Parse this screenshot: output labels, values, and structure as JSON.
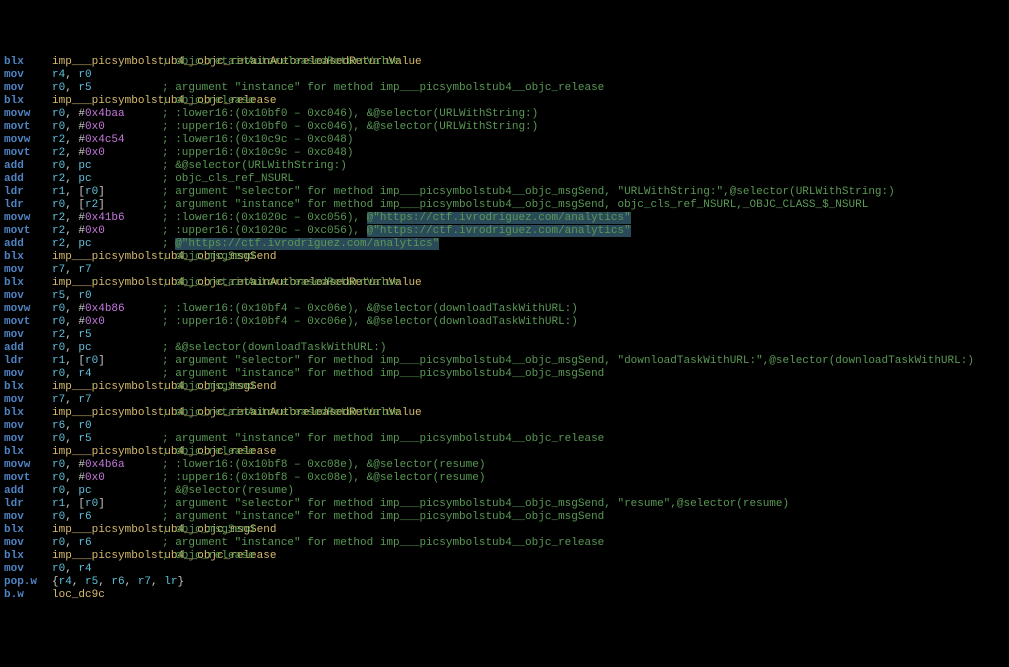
{
  "lines": [
    {
      "mn": "blx",
      "op": [
        {
          "t": "sym",
          "v": "imp___picsymbolstub4__objc_retainAutoreleasedReturnValue"
        }
      ],
      "cmt": "; objc_retainAutoreleasedReturnValue"
    },
    {
      "mn": "mov",
      "op": [
        {
          "t": "reg",
          "v": "r4"
        },
        {
          "t": "pnc",
          "v": ", "
        },
        {
          "t": "reg",
          "v": "r0"
        }
      ]
    },
    {
      "mn": "mov",
      "op": [
        {
          "t": "reg",
          "v": "r0"
        },
        {
          "t": "pnc",
          "v": ", "
        },
        {
          "t": "reg",
          "v": "r5"
        }
      ],
      "cmt": "; argument \"instance\" for method imp___picsymbolstub4__objc_release"
    },
    {
      "mn": "blx",
      "op": [
        {
          "t": "sym",
          "v": "imp___picsymbolstub4__objc_release"
        }
      ],
      "cmt": "; objc_release"
    },
    {
      "mn": "movw",
      "op": [
        {
          "t": "reg",
          "v": "r0"
        },
        {
          "t": "pnc",
          "v": ", #"
        },
        {
          "t": "num",
          "v": "0x4baa"
        }
      ],
      "cmt": "; :lower16:(0x10bf0 – 0xc046), &@selector(URLWithString:)"
    },
    {
      "mn": "movt",
      "op": [
        {
          "t": "reg",
          "v": "r0"
        },
        {
          "t": "pnc",
          "v": ", #"
        },
        {
          "t": "num",
          "v": "0x0"
        }
      ],
      "cmt": "; :upper16:(0x10bf0 – 0xc046), &@selector(URLWithString:)"
    },
    {
      "mn": "movw",
      "op": [
        {
          "t": "reg",
          "v": "r2"
        },
        {
          "t": "pnc",
          "v": ", #"
        },
        {
          "t": "num",
          "v": "0x4c54"
        }
      ],
      "cmt": "; :lower16:(0x10c9c – 0xc048)"
    },
    {
      "mn": "movt",
      "op": [
        {
          "t": "reg",
          "v": "r2"
        },
        {
          "t": "pnc",
          "v": ", #"
        },
        {
          "t": "num",
          "v": "0x0"
        }
      ],
      "cmt": "; :upper16:(0x10c9c – 0xc048)"
    },
    {
      "mn": "add",
      "op": [
        {
          "t": "reg",
          "v": "r0"
        },
        {
          "t": "pnc",
          "v": ", "
        },
        {
          "t": "reg",
          "v": "pc"
        }
      ],
      "cmt": "; &@selector(URLWithString:)"
    },
    {
      "mn": "add",
      "op": [
        {
          "t": "reg",
          "v": "r2"
        },
        {
          "t": "pnc",
          "v": ", "
        },
        {
          "t": "reg",
          "v": "pc"
        }
      ],
      "cmt": "; objc_cls_ref_NSURL"
    },
    {
      "mn": "ldr",
      "op": [
        {
          "t": "reg",
          "v": "r1"
        },
        {
          "t": "pnc",
          "v": ", ["
        },
        {
          "t": "reg",
          "v": "r0"
        },
        {
          "t": "pnc",
          "v": "]"
        }
      ],
      "cmt": "; argument \"selector\" for method imp___picsymbolstub4__objc_msgSend, \"URLWithString:\",@selector(URLWithString:)"
    },
    {
      "mn": "ldr",
      "op": [
        {
          "t": "reg",
          "v": "r0"
        },
        {
          "t": "pnc",
          "v": ", ["
        },
        {
          "t": "reg",
          "v": "r2"
        },
        {
          "t": "pnc",
          "v": "]"
        }
      ],
      "cmt": "; argument \"instance\" for method imp___picsymbolstub4__objc_msgSend, objc_cls_ref_NSURL,_OBJC_CLASS_$_NSURL"
    },
    {
      "mn": "movw",
      "op": [
        {
          "t": "reg",
          "v": "r2"
        },
        {
          "t": "pnc",
          "v": ", #"
        },
        {
          "t": "num",
          "v": "0x41b6"
        }
      ],
      "cmt": "; :lower16:(0x1020c – 0xc056), ",
      "hstr": "@\"https://ctf.ivrodriguez.com/analytics\""
    },
    {
      "mn": "movt",
      "op": [
        {
          "t": "reg",
          "v": "r2"
        },
        {
          "t": "pnc",
          "v": ", #"
        },
        {
          "t": "num",
          "v": "0x0"
        }
      ],
      "cmt": "; :upper16:(0x1020c – 0xc056), ",
      "hstr": "@\"https://ctf.ivrodriguez.com/analytics\""
    },
    {
      "mn": "add",
      "op": [
        {
          "t": "reg",
          "v": "r2"
        },
        {
          "t": "pnc",
          "v": ", "
        },
        {
          "t": "reg",
          "v": "pc"
        }
      ],
      "cmt": "; ",
      "hstr": "@\"https://ctf.ivrodriguez.com/analytics\""
    },
    {
      "mn": "blx",
      "op": [
        {
          "t": "sym",
          "v": "imp___picsymbolstub4__objc_msgSend"
        }
      ],
      "cmt": "; objc_msgSend"
    },
    {
      "mn": "mov",
      "op": [
        {
          "t": "reg",
          "v": "r7"
        },
        {
          "t": "pnc",
          "v": ", "
        },
        {
          "t": "reg",
          "v": "r7"
        }
      ]
    },
    {
      "mn": "blx",
      "op": [
        {
          "t": "sym",
          "v": "imp___picsymbolstub4__objc_retainAutoreleasedReturnValue"
        }
      ],
      "cmt": "; objc_retainAutoreleasedReturnValue"
    },
    {
      "mn": "mov",
      "op": [
        {
          "t": "reg",
          "v": "r5"
        },
        {
          "t": "pnc",
          "v": ", "
        },
        {
          "t": "reg",
          "v": "r0"
        }
      ]
    },
    {
      "mn": "movw",
      "op": [
        {
          "t": "reg",
          "v": "r0"
        },
        {
          "t": "pnc",
          "v": ", #"
        },
        {
          "t": "num",
          "v": "0x4b86"
        }
      ],
      "cmt": "; :lower16:(0x10bf4 – 0xc06e), &@selector(downloadTaskWithURL:)"
    },
    {
      "mn": "movt",
      "op": [
        {
          "t": "reg",
          "v": "r0"
        },
        {
          "t": "pnc",
          "v": ", #"
        },
        {
          "t": "num",
          "v": "0x0"
        }
      ],
      "cmt": "; :upper16:(0x10bf4 – 0xc06e), &@selector(downloadTaskWithURL:)"
    },
    {
      "mn": "mov",
      "op": [
        {
          "t": "reg",
          "v": "r2"
        },
        {
          "t": "pnc",
          "v": ", "
        },
        {
          "t": "reg",
          "v": "r5"
        }
      ]
    },
    {
      "mn": "add",
      "op": [
        {
          "t": "reg",
          "v": "r0"
        },
        {
          "t": "pnc",
          "v": ", "
        },
        {
          "t": "reg",
          "v": "pc"
        }
      ],
      "cmt": "; &@selector(downloadTaskWithURL:)"
    },
    {
      "mn": "ldr",
      "op": [
        {
          "t": "reg",
          "v": "r1"
        },
        {
          "t": "pnc",
          "v": ", ["
        },
        {
          "t": "reg",
          "v": "r0"
        },
        {
          "t": "pnc",
          "v": "]"
        }
      ],
      "cmt": "; argument \"selector\" for method imp___picsymbolstub4__objc_msgSend, \"downloadTaskWithURL:\",@selector(downloadTaskWithURL:)"
    },
    {
      "mn": "mov",
      "op": [
        {
          "t": "reg",
          "v": "r0"
        },
        {
          "t": "pnc",
          "v": ", "
        },
        {
          "t": "reg",
          "v": "r4"
        }
      ],
      "cmt": "; argument \"instance\" for method imp___picsymbolstub4__objc_msgSend"
    },
    {
      "mn": "blx",
      "op": [
        {
          "t": "sym",
          "v": "imp___picsymbolstub4__objc_msgSend"
        }
      ],
      "cmt": "; objc_msgSend"
    },
    {
      "mn": "mov",
      "op": [
        {
          "t": "reg",
          "v": "r7"
        },
        {
          "t": "pnc",
          "v": ", "
        },
        {
          "t": "reg",
          "v": "r7"
        }
      ]
    },
    {
      "mn": "blx",
      "op": [
        {
          "t": "sym",
          "v": "imp___picsymbolstub4__objc_retainAutoreleasedReturnValue"
        }
      ],
      "cmt": "; objc_retainAutoreleasedReturnValue"
    },
    {
      "mn": "mov",
      "op": [
        {
          "t": "reg",
          "v": "r6"
        },
        {
          "t": "pnc",
          "v": ", "
        },
        {
          "t": "reg",
          "v": "r0"
        }
      ]
    },
    {
      "mn": "mov",
      "op": [
        {
          "t": "reg",
          "v": "r0"
        },
        {
          "t": "pnc",
          "v": ", "
        },
        {
          "t": "reg",
          "v": "r5"
        }
      ],
      "cmt": "; argument \"instance\" for method imp___picsymbolstub4__objc_release"
    },
    {
      "mn": "blx",
      "op": [
        {
          "t": "sym",
          "v": "imp___picsymbolstub4__objc_release"
        }
      ],
      "cmt": "; objc_release"
    },
    {
      "mn": "movw",
      "op": [
        {
          "t": "reg",
          "v": "r0"
        },
        {
          "t": "pnc",
          "v": ", #"
        },
        {
          "t": "num",
          "v": "0x4b6a"
        }
      ],
      "cmt": "; :lower16:(0x10bf8 – 0xc08e), &@selector(resume)"
    },
    {
      "mn": "movt",
      "op": [
        {
          "t": "reg",
          "v": "r0"
        },
        {
          "t": "pnc",
          "v": ", #"
        },
        {
          "t": "num",
          "v": "0x0"
        }
      ],
      "cmt": "; :upper16:(0x10bf8 – 0xc08e), &@selector(resume)"
    },
    {
      "mn": "add",
      "op": [
        {
          "t": "reg",
          "v": "r0"
        },
        {
          "t": "pnc",
          "v": ", "
        },
        {
          "t": "reg",
          "v": "pc"
        }
      ],
      "cmt": "; &@selector(resume)"
    },
    {
      "mn": "ldr",
      "op": [
        {
          "t": "reg",
          "v": "r1"
        },
        {
          "t": "pnc",
          "v": ", ["
        },
        {
          "t": "reg",
          "v": "r0"
        },
        {
          "t": "pnc",
          "v": "]"
        }
      ],
      "cmt": "; argument \"selector\" for method imp___picsymbolstub4__objc_msgSend, \"resume\",@selector(resume)"
    },
    {
      "mn": "mov",
      "op": [
        {
          "t": "reg",
          "v": "r0"
        },
        {
          "t": "pnc",
          "v": ", "
        },
        {
          "t": "reg",
          "v": "r6"
        }
      ],
      "cmt": "; argument \"instance\" for method imp___picsymbolstub4__objc_msgSend"
    },
    {
      "mn": "blx",
      "op": [
        {
          "t": "sym",
          "v": "imp___picsymbolstub4__objc_msgSend"
        }
      ],
      "cmt": "; objc_msgSend"
    },
    {
      "mn": "mov",
      "op": [
        {
          "t": "reg",
          "v": "r0"
        },
        {
          "t": "pnc",
          "v": ", "
        },
        {
          "t": "reg",
          "v": "r6"
        }
      ],
      "cmt": "; argument \"instance\" for method imp___picsymbolstub4__objc_release"
    },
    {
      "mn": "blx",
      "op": [
        {
          "t": "sym",
          "v": "imp___picsymbolstub4__objc_release"
        }
      ],
      "cmt": "; objc_release"
    },
    {
      "mn": "mov",
      "op": [
        {
          "t": "reg",
          "v": "r0"
        },
        {
          "t": "pnc",
          "v": ", "
        },
        {
          "t": "reg",
          "v": "r4"
        }
      ]
    },
    {
      "mn": "pop.w",
      "op": [
        {
          "t": "pnc",
          "v": "{"
        },
        {
          "t": "reg",
          "v": "r4"
        },
        {
          "t": "pnc",
          "v": ", "
        },
        {
          "t": "reg",
          "v": "r5"
        },
        {
          "t": "pnc",
          "v": ", "
        },
        {
          "t": "reg",
          "v": "r6"
        },
        {
          "t": "pnc",
          "v": ", "
        },
        {
          "t": "reg",
          "v": "r7"
        },
        {
          "t": "pnc",
          "v": ", "
        },
        {
          "t": "reg",
          "v": "lr"
        },
        {
          "t": "pnc",
          "v": "}"
        }
      ]
    },
    {
      "mn": "b.w",
      "op": [
        {
          "t": "sym",
          "v": "loc_dc9c"
        }
      ]
    }
  ]
}
